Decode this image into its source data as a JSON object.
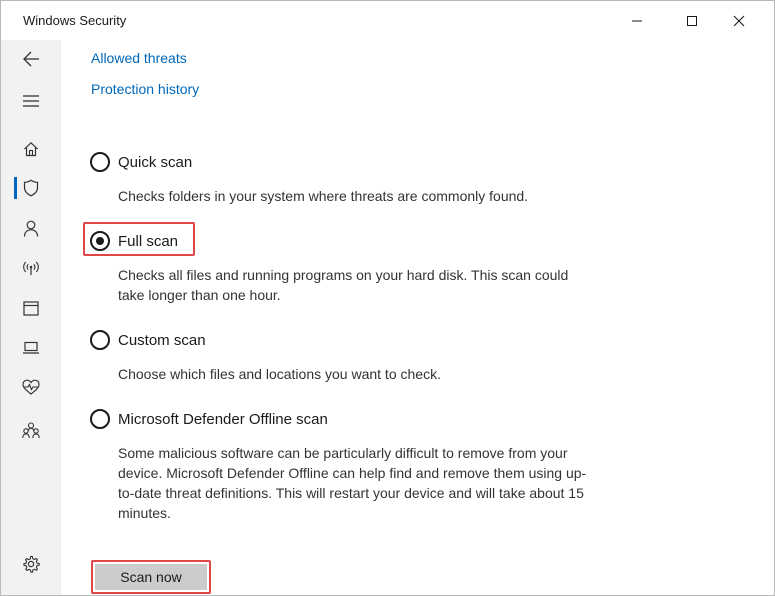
{
  "window": {
    "title": "Windows Security",
    "controls": {
      "minimize_icon": "minimize-icon",
      "maximize_icon": "maximize-icon",
      "close_icon": "close-icon"
    }
  },
  "sidebar": {
    "items": [
      {
        "name": "back",
        "icon": "back-arrow-icon"
      },
      {
        "name": "menu",
        "icon": "hamburger-icon"
      },
      {
        "name": "home",
        "icon": "home-icon"
      },
      {
        "name": "virus-protection",
        "icon": "shield-icon",
        "active": true
      },
      {
        "name": "account-protection",
        "icon": "person-icon"
      },
      {
        "name": "firewall",
        "icon": "network-icon"
      },
      {
        "name": "app-browser-control",
        "icon": "window-icon"
      },
      {
        "name": "device-security",
        "icon": "laptop-icon"
      },
      {
        "name": "device-performance",
        "icon": "heart-pulse-icon"
      },
      {
        "name": "family-options",
        "icon": "family-icon"
      },
      {
        "name": "settings",
        "icon": "gear-icon"
      }
    ],
    "accent_color": "#0067c0"
  },
  "links": {
    "allowed_threats": "Allowed threats",
    "protection_history": "Protection history"
  },
  "scan_options": {
    "quick": {
      "label": "Quick scan",
      "description": "Checks folders in your system where threats are commonly found.",
      "selected": false
    },
    "full": {
      "label": "Full scan",
      "description": "Checks all files and running programs on your hard disk. This scan could take longer than one hour.",
      "selected": true
    },
    "custom": {
      "label": "Custom scan",
      "description": "Choose which files and locations you want to check.",
      "selected": false
    },
    "offline": {
      "label": "Microsoft Defender Offline scan",
      "description": "Some malicious software can be particularly difficult to remove from your device. Microsoft Defender Offline can help find and remove them using up-to-date threat definitions. This will restart your device and will take about 15 minutes.",
      "selected": false
    }
  },
  "actions": {
    "scan_now": "Scan now"
  },
  "colors": {
    "link": "#0067b8",
    "highlight": "#e04848",
    "button_bg": "#cccccc"
  }
}
